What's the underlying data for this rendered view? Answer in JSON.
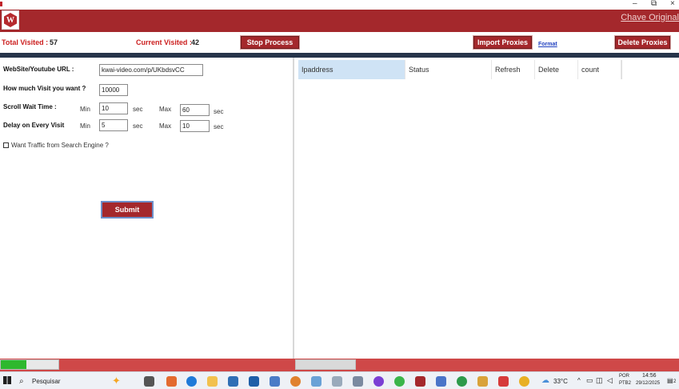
{
  "window": {
    "controls": {
      "minimize": "–",
      "maximize": "⧉",
      "close": "×"
    }
  },
  "banner": {
    "logo_letter": "W",
    "right_link": "Chave Original"
  },
  "stats": {
    "total_label": "Total Visited :",
    "total_value": "57",
    "current_label": "Current Visited :",
    "current_value": "42"
  },
  "toolbar": {
    "stop_label": "Stop Process",
    "import_label": "Import Proxies",
    "format_label": "Format",
    "delete_label": "Delete Proxies"
  },
  "form": {
    "url_label": "WebSite/Youtube URL :",
    "url_value": "kwai-video.com/p/UKbdsvCC",
    "visits_label": "How much Visit you want ?",
    "visits_value": "10000",
    "scroll_label": "Scroll Wait Time :",
    "delay_label": "Delay on Every Visit",
    "min_label": "Min",
    "max_label": "Max",
    "sec_label": "sec",
    "scroll_min": "10",
    "scroll_max": "60",
    "delay_min": "5",
    "delay_max": "10",
    "traffic_label": "Want Traffic from Search Engine ?",
    "traffic_checked": false,
    "submit_label": "Submit"
  },
  "grid": {
    "columns": [
      "Ipaddress",
      "Status",
      "Refresh",
      "Delete",
      "count"
    ]
  },
  "progress": {
    "fraction": 0.45
  },
  "taskbar": {
    "search_placeholder": "Pesquisar",
    "temperature": "33°C",
    "language": "POR",
    "layout": "PTB2",
    "time": "14:56",
    "date": "29/12/2025",
    "notifications": "2"
  },
  "colors": {
    "brand": "#a4282c",
    "accent_link": "#1f3fbf",
    "progress": "#2eb82e"
  }
}
